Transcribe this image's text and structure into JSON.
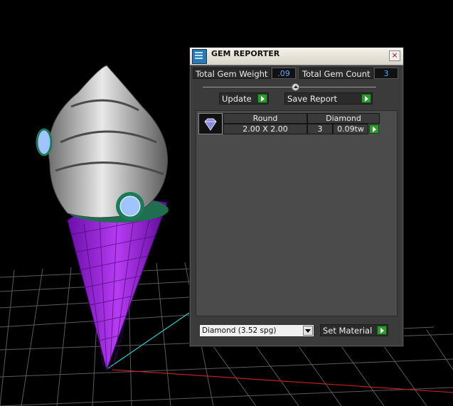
{
  "window": {
    "title": "GEM REPORTER",
    "close_symbol": "×"
  },
  "stats": {
    "total_weight_label": "Total Gem Weight",
    "total_weight_value": ".09",
    "total_count_label": "Total Gem Count",
    "total_count_value": "3"
  },
  "actions": {
    "update_label": "Update",
    "save_report_label": "Save Report"
  },
  "gem_table": {
    "rows": [
      {
        "shape": "Round",
        "size": "2.00 X 2.00",
        "material": "Diamond",
        "count": "3",
        "weight": "0.09tw"
      }
    ]
  },
  "material": {
    "selected": "Diamond     (3.52 spg)",
    "set_label": "Set Material"
  },
  "colors": {
    "accent_value": "#4fb0ff",
    "go_button": "#2f9a2f",
    "cone": "#9a1fd8",
    "grid": "#5a5a5a"
  },
  "icons": [
    "app-icon",
    "close-icon",
    "gem-icon",
    "go-arrow-icon",
    "dropdown-arrow-icon"
  ]
}
